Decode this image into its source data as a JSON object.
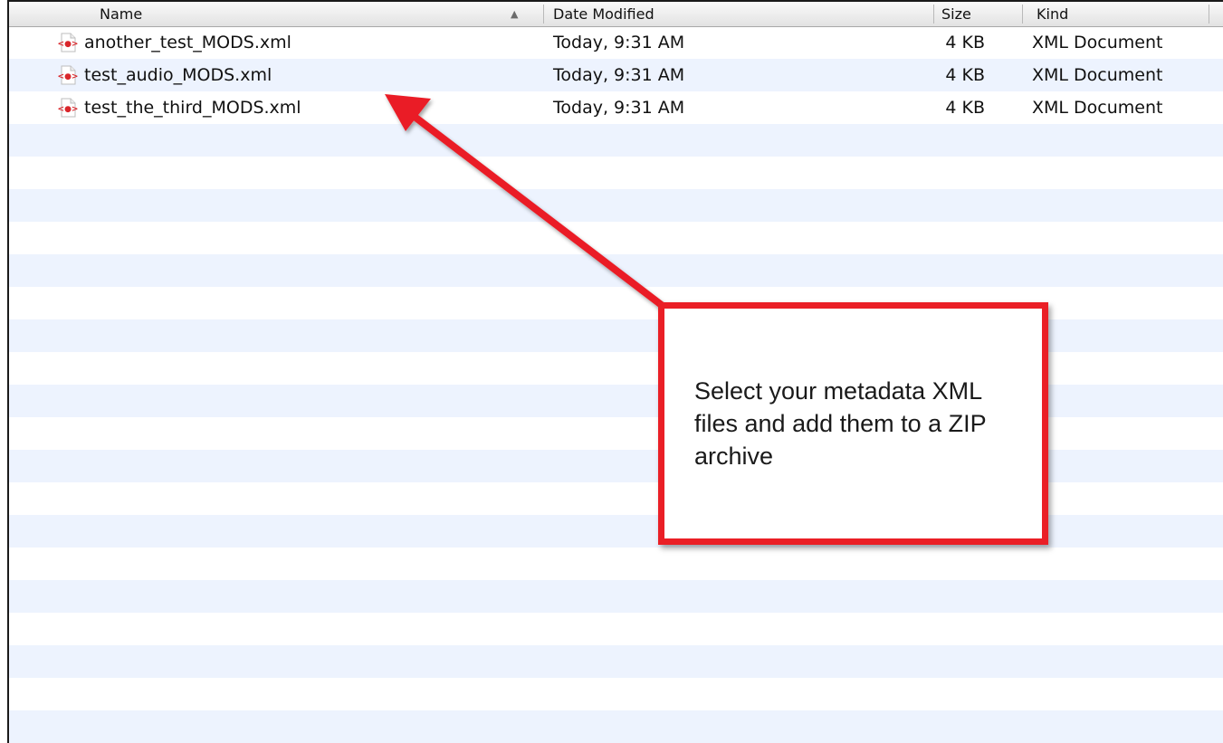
{
  "columns": {
    "name": "Name",
    "date_modified": "Date Modified",
    "size": "Size",
    "kind": "Kind"
  },
  "sort_indicator": "▲",
  "files": [
    {
      "name": "another_test_MODS.xml",
      "date": "Today, 9:31 AM",
      "size": "4 KB",
      "kind": "XML Document",
      "icon": "xml-file-icon"
    },
    {
      "name": "test_audio_MODS.xml",
      "date": "Today, 9:31 AM",
      "size": "4 KB",
      "kind": "XML Document",
      "icon": "xml-file-icon"
    },
    {
      "name": "test_the_third_MODS.xml",
      "date": "Today, 9:31 AM",
      "size": "4 KB",
      "kind": "XML Document",
      "icon": "xml-file-icon"
    }
  ],
  "annotation": {
    "text": "Select your metadata XML files and add them to a ZIP archive",
    "border_color": "#ea1f26",
    "arrow_color": "#ea1f26"
  },
  "colors": {
    "row_stripe": "#edf3fe",
    "xml_icon_red": "#d9262b"
  }
}
